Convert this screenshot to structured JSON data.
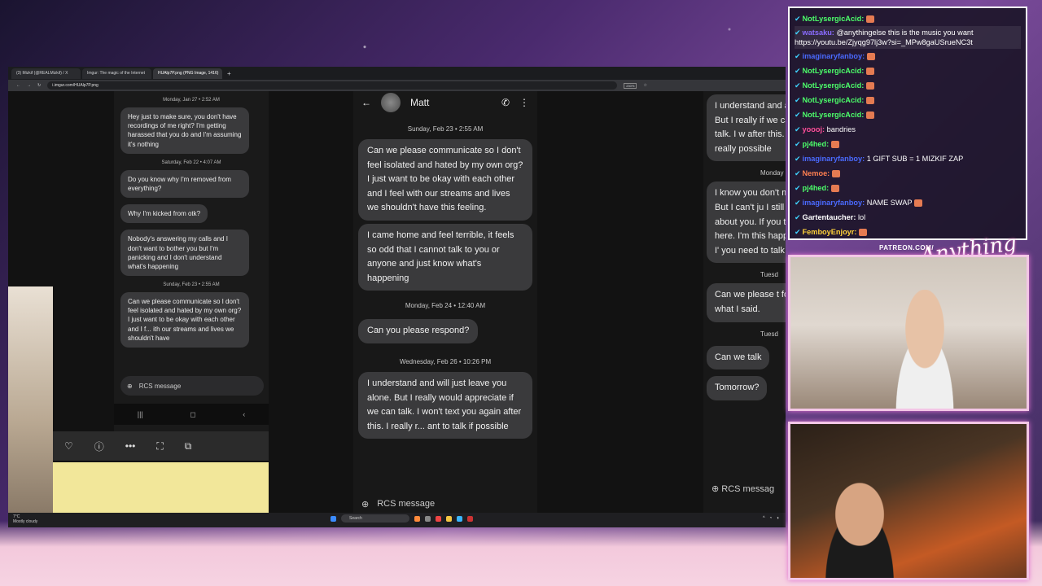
{
  "browser": {
    "tabs": [
      {
        "label": "(3) Mizkif (@REALMizkif) / X"
      },
      {
        "label": "Imgur: The magic of the Internet"
      },
      {
        "label": "HUAlp7P.png (PNG Image, 1416)",
        "active": true
      }
    ],
    "url": "i.imgur.com/HUAlp7P.png",
    "zoom": "230%"
  },
  "phone_small": {
    "messages": [
      {
        "type": "ts",
        "text": "Monday, Jan 27 • 2:52 AM"
      },
      {
        "type": "msg",
        "text": "Hey just to make sure, you don't have recordings of me right? I'm getting harassed that you do and I'm assuming it's nothing"
      },
      {
        "type": "ts",
        "text": "Saturday, Feb 22 • 4:07 AM"
      },
      {
        "type": "msg",
        "text": "Do you know why I'm removed from everything?"
      },
      {
        "type": "msg",
        "text": "Why I'm kicked from otk?",
        "short": true
      },
      {
        "type": "msg",
        "text": "Nobody's answering my calls and I don't want to bother you but I'm panicking and I don't understand what's happening"
      },
      {
        "type": "ts",
        "text": "Sunday, Feb 23 • 2:55 AM"
      },
      {
        "type": "msg",
        "text": "Can we please communicate so I don't feel isolated and hated by my own org? I just want to be okay with each other and I f... ith our streams and lives we shouldn't have"
      }
    ],
    "compose_placeholder": "RCS message"
  },
  "phone_mid": {
    "contact": "Matt",
    "messages": [
      {
        "type": "ts",
        "text": "Sunday, Feb 23 • 2:55 AM"
      },
      {
        "type": "msg",
        "text": "Can we please communicate so I don't feel isolated and hated by my own org? I just want to be okay with each other and I feel with our streams and lives we shouldn't have this feeling."
      },
      {
        "type": "msg",
        "text": "I came home and feel terrible, it feels so odd that I cannot talk to you or anyone and just know what's happening"
      },
      {
        "type": "ts",
        "text": "Monday, Feb 24 • 12:40 AM"
      },
      {
        "type": "msg",
        "text": "Can you please respond?",
        "short": true
      },
      {
        "type": "ts",
        "text": "Wednesday, Feb 26 • 10:26 PM"
      },
      {
        "type": "msg",
        "text": "I understand and will just leave you alone. But I really would appreciate if we can talk. I won't text you again after this. I really r... ant to talk if possible"
      }
    ],
    "compose_placeholder": "RCS message"
  },
  "phone_right": {
    "messages": [
      {
        "type": "msg",
        "text": "I understand and alone. But I really if we can talk. I w after this. I really possible"
      },
      {
        "type": "ts",
        "text": "Monday"
      },
      {
        "type": "msg",
        "text": "I know you don't me. But I can't ju I still care about you. If you talk I'm here. I'm this happened I' you need to talk"
      },
      {
        "type": "ts",
        "text": "Tuesd"
      },
      {
        "type": "msg",
        "text": "Can we please t for what I said."
      },
      {
        "type": "ts",
        "text": "Tuesd"
      },
      {
        "type": "msg",
        "text": "Can we talk",
        "short": true
      },
      {
        "type": "msg",
        "text": "Tomorrow?",
        "short": true
      }
    ],
    "compose_placeholder": "RCS messag"
  },
  "taskbar": {
    "weather_temp": "7°C",
    "weather_desc": "Mostly cloudy",
    "search": "Search"
  },
  "chat": [
    {
      "user": "NotLysergicAcid:",
      "color": "#4cff6a",
      "text": "",
      "emote": true
    },
    {
      "user": "watsaku:",
      "color": "#8a6cff",
      "text": "@anythingelse this is the music you want https://youtu.be/Zjyqg97lj3w?si=_MPw8gaUSrueNC3t",
      "wrap": true,
      "hl": true
    },
    {
      "user": "imaginaryfanboy:",
      "color": "#4a6aff",
      "text": "",
      "emote": true
    },
    {
      "user": "NotLysergicAcid:",
      "color": "#4cff6a",
      "text": "",
      "emote": true
    },
    {
      "user": "NotLysergicAcid:",
      "color": "#4cff6a",
      "text": "",
      "emote": true
    },
    {
      "user": "NotLysergicAcid:",
      "color": "#4cff6a",
      "text": "",
      "emote": true
    },
    {
      "user": "NotLysergicAcid:",
      "color": "#4cff6a",
      "text": "",
      "emote": true
    },
    {
      "user": "yoooj:",
      "color": "#ff4f9a",
      "text": "bandries"
    },
    {
      "user": "pj4hed:",
      "color": "#4cff6a",
      "text": "",
      "emote": true
    },
    {
      "user": "imaginaryfanboy:",
      "color": "#4a6aff",
      "text": "1 GIFT SUB = 1 MIZKIF ZAP"
    },
    {
      "user": "Nemoe:",
      "color": "#ff7f50",
      "text": "",
      "emote": true
    },
    {
      "user": "pj4hed:",
      "color": "#4cff6a",
      "text": "",
      "emote": true
    },
    {
      "user": "imaginaryfanboy:",
      "color": "#4a6aff",
      "text": "NAME SWAP",
      "emote": true
    },
    {
      "user": "Gartentaucher:",
      "color": "#ffffff",
      "text": "lol"
    },
    {
      "user": "FemboyEnjoyr:",
      "color": "#ffd23a",
      "text": "",
      "emote": true
    }
  ],
  "overlay": {
    "patreon": "PATREON.COM/",
    "brand": "Anything Else"
  },
  "colors": {
    "accent_pink": "#f3c6e6",
    "bubble": "#3a3a3c"
  }
}
